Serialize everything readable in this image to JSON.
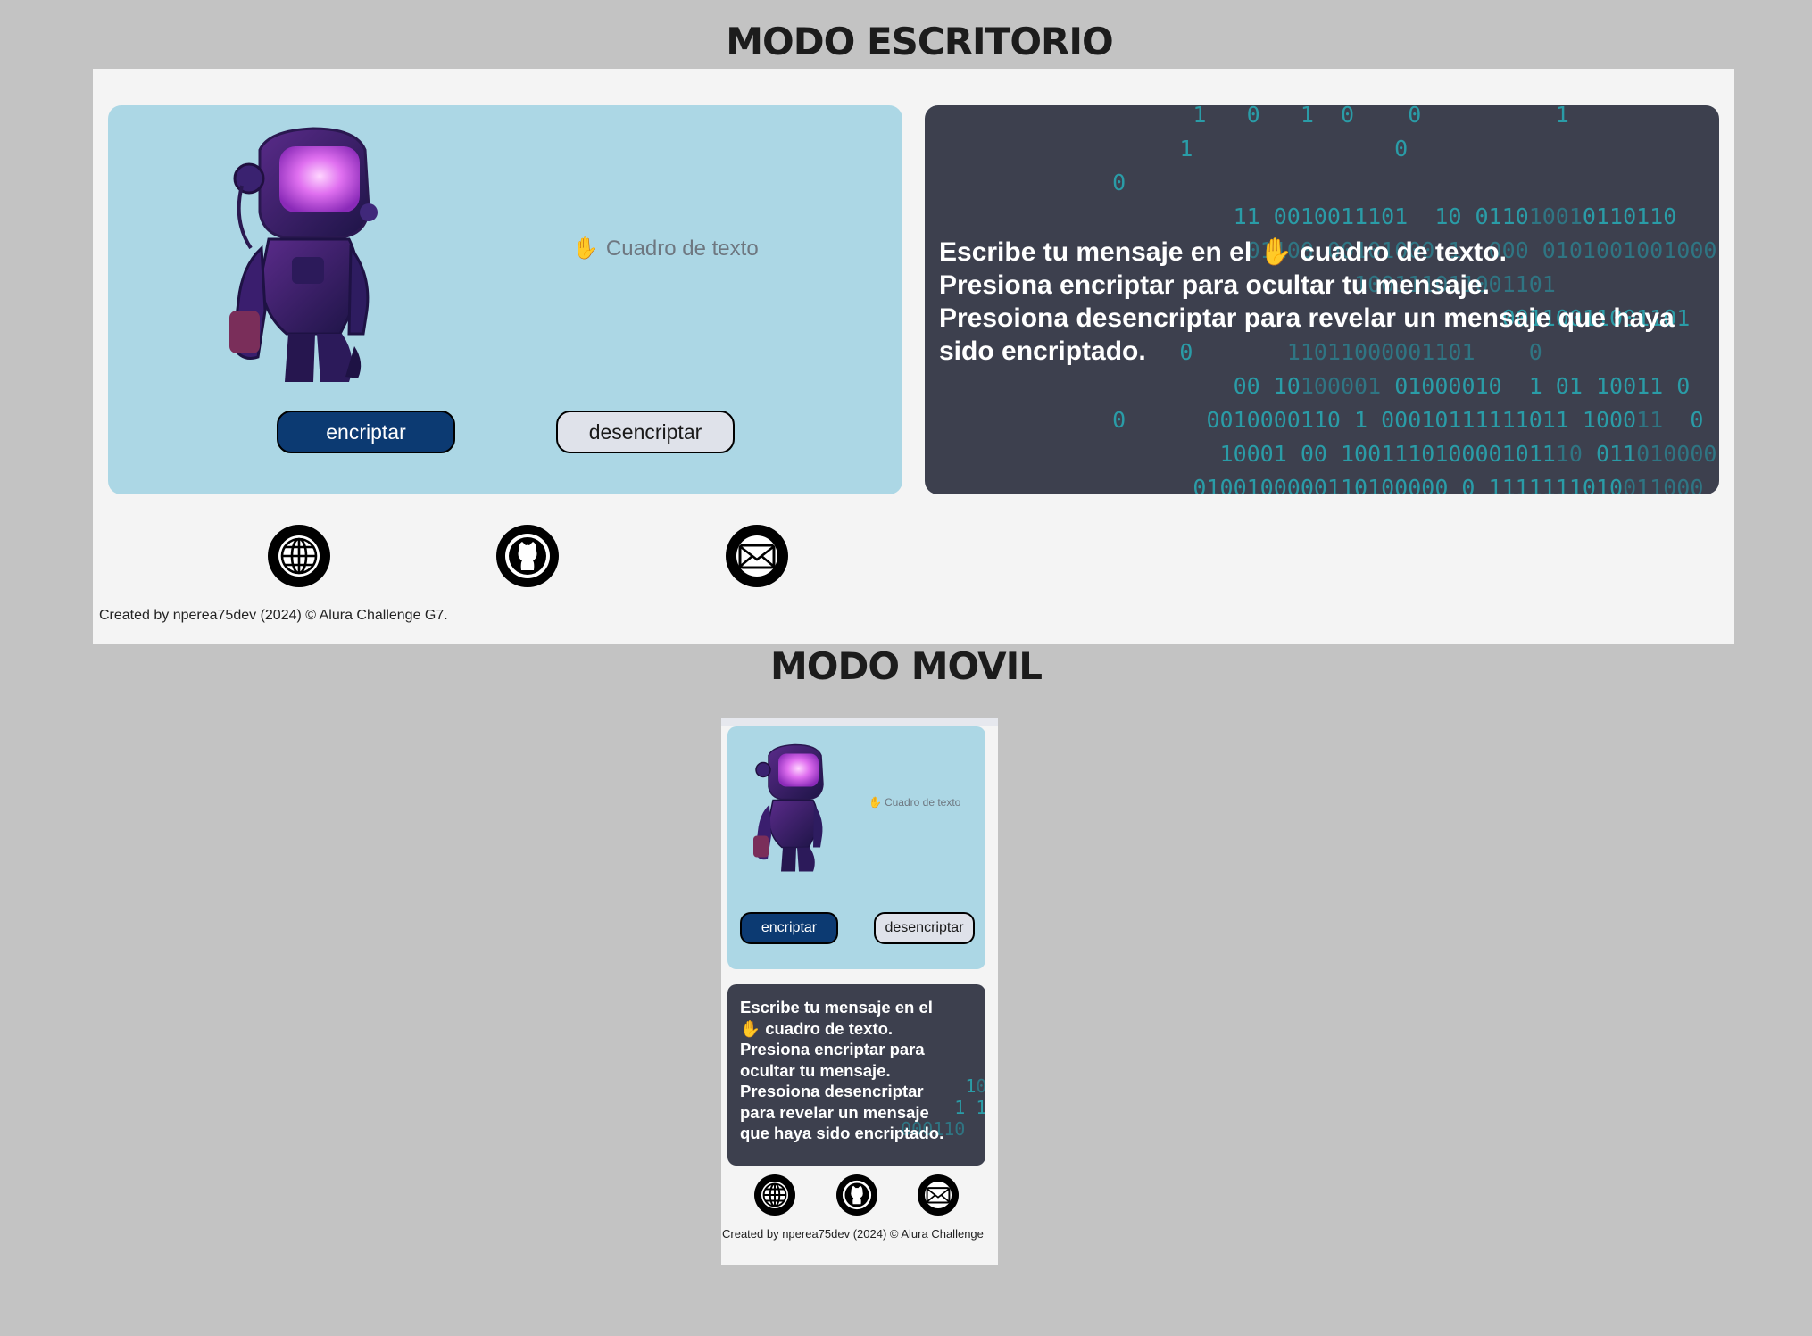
{
  "headings": {
    "desktop": "MODO ESCRITORIO",
    "mobile": "MODO MOVIL"
  },
  "textbox": {
    "hand_icon": "✋",
    "placeholder": "Cuadro de texto"
  },
  "buttons": {
    "encrypt": "encriptar",
    "decrypt": "desencriptar"
  },
  "info": {
    "line1_a": "Escribe tu mensaje en el",
    "line1_b": "cuadro de texto.",
    "line2": "Presiona encriptar para ocultar tu mensaje.",
    "line3": "Presoiona desencriptar para revelar un mensaje que haya sido encriptado.",
    "mobile_lines": [
      "Presiona encriptar para",
      "ocultar tu mensaje.",
      "Presoiona desencriptar",
      "para revelar un mensaje",
      "que haya sido encriptado."
    ],
    "mobile_line1": "Escribe tu mensaje en el"
  },
  "footer": {
    "desktop": "Created by nperea75dev (2024) © Alura Challenge G7.",
    "mobile": "Created by nperea75dev (2024) © Alura Challenge"
  },
  "icons": [
    "globe-icon",
    "github-icon",
    "mail-icon"
  ],
  "colors": {
    "page_bg": "#c3c3c3",
    "frame_bg": "#f4f4f4",
    "left_panel": "#acd7e5",
    "right_panel": "#3d404e",
    "encrypt_btn": "#0c3a72",
    "decrypt_btn": "#dfe2ea",
    "matrix_text": "#2a9ca7"
  }
}
